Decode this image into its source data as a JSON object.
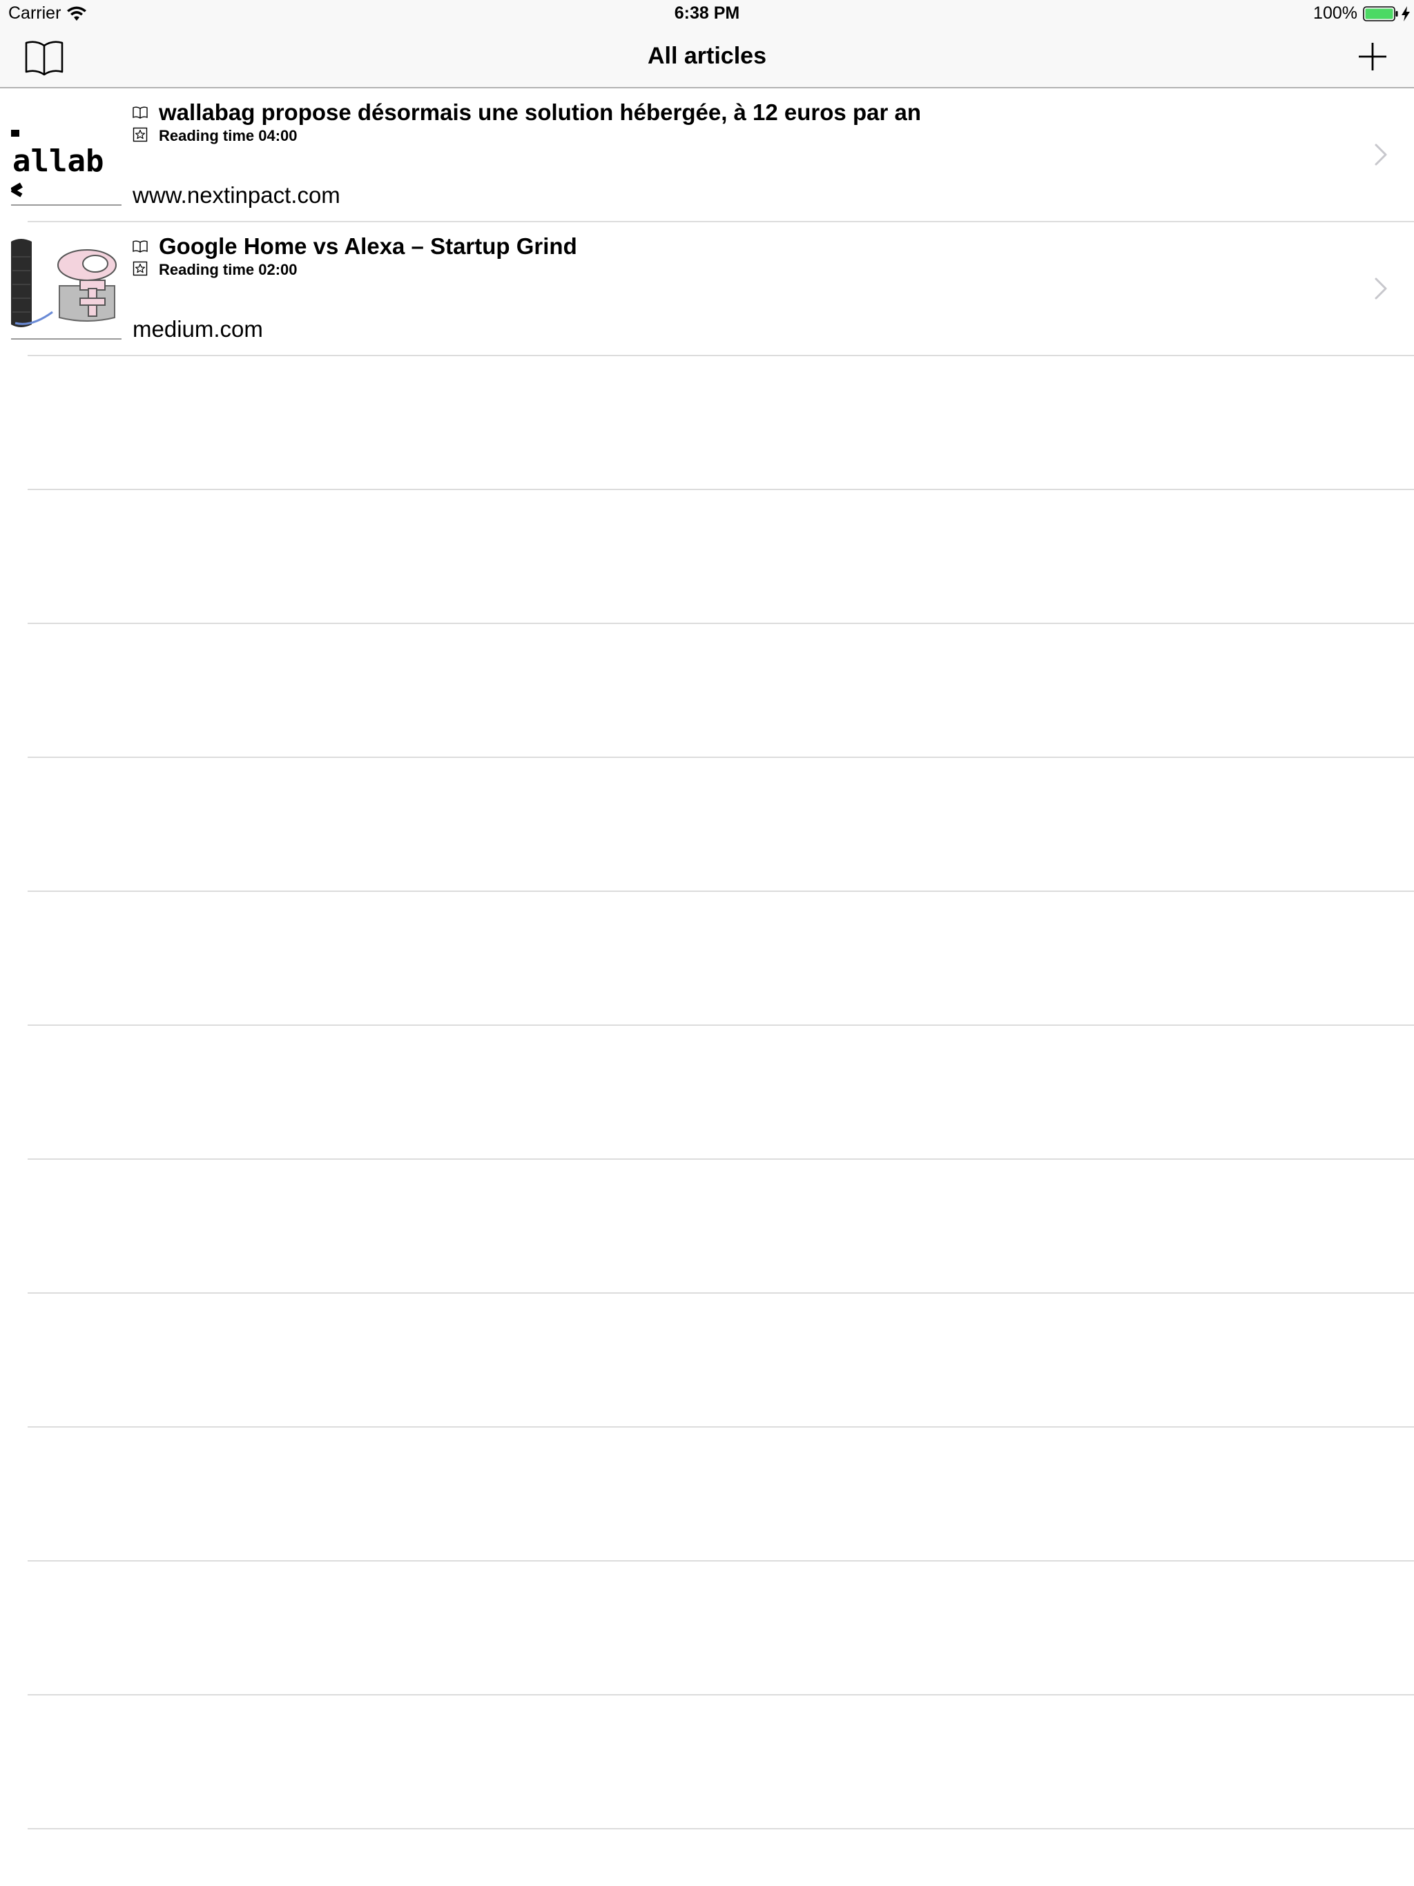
{
  "status_bar": {
    "carrier": "Carrier",
    "time": "6:38 PM",
    "battery": "100%",
    "icons": [
      "wifi-icon",
      "battery-icon",
      "charging-bolt-icon"
    ],
    "battery_color": "#4cd964"
  },
  "nav_bar": {
    "title": "All articles",
    "left_icon": "book-icon",
    "right_icon": "plus-icon"
  },
  "articles": [
    {
      "title": "wallabag propose désormais une solution hébergée, à 12 euros par an",
      "reading_time": "Reading time 04:00",
      "domain": "www.nextinpact.com",
      "thumbnail_text": "allab",
      "icons": [
        "book-icon",
        "star-icon",
        "chevron-right-icon"
      ]
    },
    {
      "title": "Google Home vs Alexa – Startup Grind",
      "reading_time": "Reading time 02:00",
      "domain": "medium.com",
      "icons": [
        "book-icon",
        "star-icon",
        "chevron-right-icon"
      ]
    }
  ],
  "colors": {
    "bar_background": "#f8f8f8",
    "separator": "#dcdcdc",
    "chevron": "#c7c7cc"
  }
}
